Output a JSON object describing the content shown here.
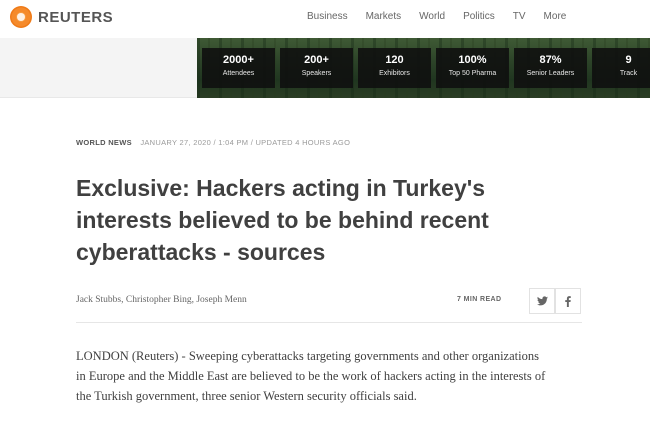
{
  "header": {
    "logo_text": "REUTERS",
    "nav": [
      "Business",
      "Markets",
      "World",
      "Politics",
      "TV",
      "More"
    ]
  },
  "banner": {
    "stats": [
      {
        "value": "2000+",
        "label": "Attendees"
      },
      {
        "value": "200+",
        "label": "Speakers"
      },
      {
        "value": "120",
        "label": "Exhibitors"
      },
      {
        "value": "100%",
        "label": "Top 50 Pharma"
      },
      {
        "value": "87%",
        "label": "Senior Leaders"
      },
      {
        "value": "9",
        "label": "Track"
      }
    ]
  },
  "article": {
    "section": "WORLD NEWS",
    "date": "JANUARY 27, 2020 / 1:04 PM / UPDATED 4 HOURS AGO",
    "headline": "Exclusive: Hackers acting in Turkey's interests believed to be behind recent cyberattacks - sources",
    "authors": "Jack Stubbs, Christopher Bing, Joseph Menn",
    "read_time": "7 MIN READ",
    "body": "LONDON (Reuters) - Sweeping cyberattacks targeting governments and other organizations in Europe and the Middle East are believed to be the work of hackers acting in the interests of the Turkish government, three senior Western security officials said."
  },
  "icons": {
    "twitter": "twitter-icon",
    "facebook": "facebook-icon"
  },
  "colors": {
    "brand_orange": "#f58a2a",
    "stat_box": "#0f0f0f",
    "text": "#404040"
  }
}
